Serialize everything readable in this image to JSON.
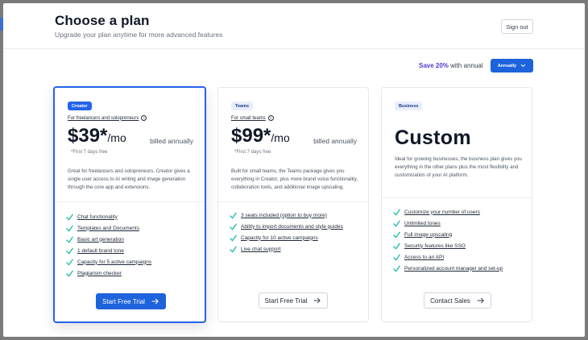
{
  "header": {
    "title": "Choose a plan",
    "subtitle": "Upgrade your plan anytime for more advanced features",
    "signout_label": "Sign out"
  },
  "billing": {
    "save_pct": "Save 20%",
    "save_suffix": "with annual",
    "period_label": "Annually",
    "chevron_icon": "chevron-down-icon"
  },
  "colors": {
    "primary": "#1d63dc",
    "save_accent": "#4c3bcf",
    "check": "#14b8a6"
  },
  "plans": [
    {
      "badge": "Creator",
      "audience": "For freelancers and solopreneurs",
      "price": "$39*",
      "unit": "/mo",
      "billed": "billed annually",
      "trial_note": "*First 7 days free",
      "description": "Great for freelancers and solopreneurs. Creator gives a single user access to AI writing and image generation through the core app and extensions.",
      "features": [
        "Chat functionality",
        "Templates and Documents",
        "Basic art generation",
        "1 default brand tone",
        "Capacity for 5 active campaigns",
        "Plagiarism checker"
      ],
      "cta": "Start Free Trial"
    },
    {
      "badge": "Teams",
      "audience": "For small teams",
      "price": "$99*",
      "unit": "/mo",
      "billed": "billed annually",
      "trial_note": "*First 7 days free",
      "description": "Built for small teams, the Teams package gives you everything in Creator, plus more brand voice functionality, collaboration tools, and additional image upscaling.",
      "features": [
        "3 seats included (option to buy more)",
        "Ability to import documents and style guides",
        "Capacity for 10 active campaigns",
        "Live chat support"
      ],
      "cta": "Start Free Trial"
    },
    {
      "badge": "Business",
      "price": "Custom",
      "description": "Ideal for growing businesses, the business plan gives you everything in the other plans plus the most flexibility and customization of your AI platform.",
      "features": [
        "Customize your number of users",
        "Unlimited tones",
        "Full image upscaling",
        "Security features like SSO",
        "Access to an API",
        "Personalized account manager and set-up"
      ],
      "cta": "Contact Sales"
    }
  ]
}
